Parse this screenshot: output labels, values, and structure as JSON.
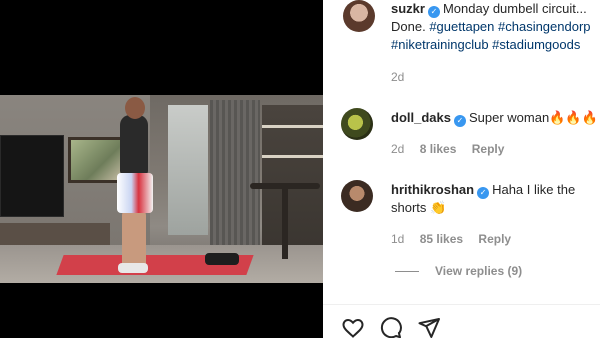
{
  "post": {
    "author": "suzkr",
    "caption_line1": "Monday dumbell circuit...",
    "caption_line2_text": "Done.",
    "caption_line2_tags": "#guettapen #chasingendorp",
    "caption_line3_tags": "#niketrainingclub #stadiumgoods",
    "time": "2d"
  },
  "comments": [
    {
      "username": "doll_daks",
      "text": "Super woman🔥🔥🔥",
      "time": "2d",
      "likes": "8 likes",
      "reply": "Reply"
    },
    {
      "username": "hrithikroshan",
      "text": "Haha I like the",
      "text_line2": "shorts 👏",
      "time": "1d",
      "likes": "85 likes",
      "reply": "Reply",
      "view_replies": "View replies (9)"
    }
  ],
  "icons": {
    "verified": "verified-badge-icon",
    "like": "heart-icon",
    "comment": "comment-icon",
    "share": "send-icon"
  },
  "colors": {
    "verified": "#3897f0",
    "hashtag": "#00376b",
    "meta": "#8e8e8e"
  }
}
